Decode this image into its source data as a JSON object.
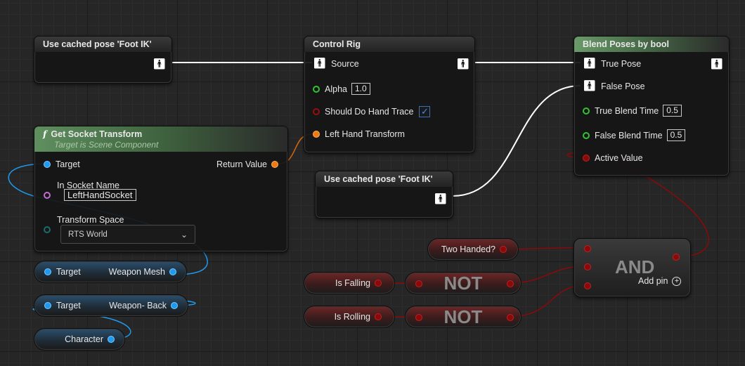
{
  "nodes": {
    "cached_pose_1": {
      "title": "Use cached pose 'Foot IK'"
    },
    "cached_pose_2": {
      "title": "Use cached pose 'Foot IK'"
    },
    "control_rig": {
      "title": "Control Rig",
      "source": "Source",
      "alpha_label": "Alpha",
      "alpha_value": "1.0",
      "hand_trace_label": "Should Do Hand Trace",
      "hand_trace_checked": true,
      "left_hand_label": "Left Hand Transform"
    },
    "blend_poses": {
      "title": "Blend Poses by bool",
      "true_pose": "True Pose",
      "false_pose": "False Pose",
      "true_blend_label": "True Blend Time",
      "true_blend_value": "0.5",
      "false_blend_label": "False Blend Time",
      "false_blend_value": "0.5",
      "active_value": "Active Value"
    },
    "get_socket": {
      "title": "Get Socket Transform",
      "subtitle": "Target is Scene Component",
      "target": "Target",
      "return_value": "Return Value",
      "socket_name_label": "In Socket Name",
      "socket_name_value": "LeftHandSocket",
      "space_label": "Transform Space",
      "space_value": "RTS World"
    },
    "weapon_mesh": {
      "target": "Target",
      "label": "Weapon Mesh"
    },
    "weapon_back": {
      "target": "Target",
      "label": "Weapon- Back"
    },
    "character": {
      "label": "Character"
    },
    "two_handed": {
      "label": "Two Handed?"
    },
    "is_falling": {
      "label": "Is Falling"
    },
    "is_rolling": {
      "label": "Is Rolling"
    },
    "not_1": {
      "label": "NOT"
    },
    "not_2": {
      "label": "NOT"
    },
    "and_node": {
      "label": "AND",
      "add_pin": "Add pin"
    }
  },
  "icons": {
    "pose_pin": "person-figure-icon",
    "exec_function": "function-f-icon",
    "dropdown": "chevron-down-icon",
    "add": "plus-circle-icon",
    "check": "checkmark-icon"
  },
  "colors": {
    "object_pin": "#1e9bf0",
    "transform_pin": "#f07a10",
    "bool_pin": "#8a0a0a",
    "float_pin": "#34c234",
    "name_pin": "#c070d0",
    "pose_wire": "#ffffff",
    "graph_bg": "#262626"
  }
}
